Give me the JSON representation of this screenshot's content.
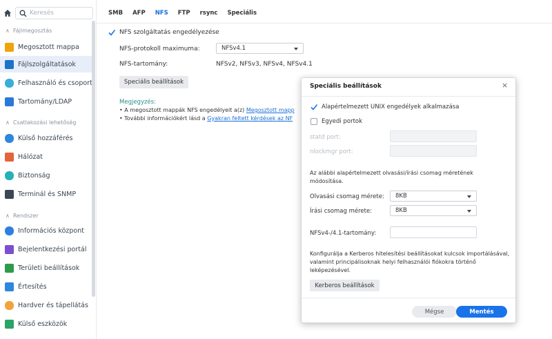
{
  "sidebar": {
    "search_placeholder": "Keresés",
    "sections": [
      {
        "label": "Fájlmegosztás"
      },
      {
        "label": "Csatlakozási lehetőség"
      },
      {
        "label": "Rendszer"
      }
    ],
    "items": [
      {
        "label": "Megosztott mappa",
        "color": "#f0a30a"
      },
      {
        "label": "Fájlszolgáltatások",
        "color": "#1a73c9"
      },
      {
        "label": "Felhasználó és csoport",
        "color": "#3aaed8"
      },
      {
        "label": "Tartomány/LDAP",
        "color": "#2a7ad6"
      },
      {
        "label": "Külső hozzáférés",
        "color": "#2f86de"
      },
      {
        "label": "Hálózat",
        "color": "#e2643a"
      },
      {
        "label": "Biztonság",
        "color": "#25b1b6"
      },
      {
        "label": "Terminál és SNMP",
        "color": "#3b4754"
      },
      {
        "label": "Információs központ",
        "color": "#2f7fe0"
      },
      {
        "label": "Bejelentkezési portál",
        "color": "#7a4fd0"
      },
      {
        "label": "Területi beállítások",
        "color": "#2e9b4c"
      },
      {
        "label": "Értesítés",
        "color": "#2f86de"
      },
      {
        "label": "Hardver és tápellátás",
        "color": "#f2a33a"
      },
      {
        "label": "Külső eszközök",
        "color": "#29a56a"
      }
    ]
  },
  "tabs": [
    "SMB",
    "AFP",
    "NFS",
    "FTP",
    "rsync",
    "Speciális"
  ],
  "main": {
    "enable_nfs": "NFS szolgáltatás engedélyezése",
    "protocol_label": "NFS-protokoll maximuma:",
    "protocol_value": "NFSv4.1",
    "range_label": "NFS-tartomány:",
    "range_value": "NFSv2, NFSv3, NFSv4, NFSv4.1",
    "advanced_button": "Speciális beállítások",
    "note_title": "Megjegyzés:",
    "note1_prefix": "• A megosztott mappák NFS engedélyeit a(z)",
    "note1_link": "Megosztott mapp",
    "note2_prefix": "• További információkért lásd a",
    "note2_link": "Gyakran feltett kérdések az NF"
  },
  "dialog": {
    "title": "Speciális beállítások",
    "close": "×",
    "unix_label": "Alapértelmezett UNIX engedélyek alkalmazása",
    "custom_ports": "Egyedi portok",
    "statd_label": "statd port:",
    "nlockmgr_label": "nlockmgr port:",
    "packet_desc": "Az alábbi alapértelmezett olvasási/írási csomag méretének módosítása.",
    "read_label": "Olvasási csomag mérete:",
    "read_value": "8KB",
    "write_label": "Írási csomag mérete:",
    "write_value": "8KB",
    "domain_label": "NFSv4-/4.1-tartomány:",
    "kerberos_desc": "Konfigurálja a Kerberos hitelesítési beállításokat kulcsok importálásával, valamint principálisoknak helyi felhasználói fiókokra történő leképezésével.",
    "kerberos_button": "Kerberos beállítások",
    "cancel": "Mégse",
    "save": "Mentés"
  }
}
